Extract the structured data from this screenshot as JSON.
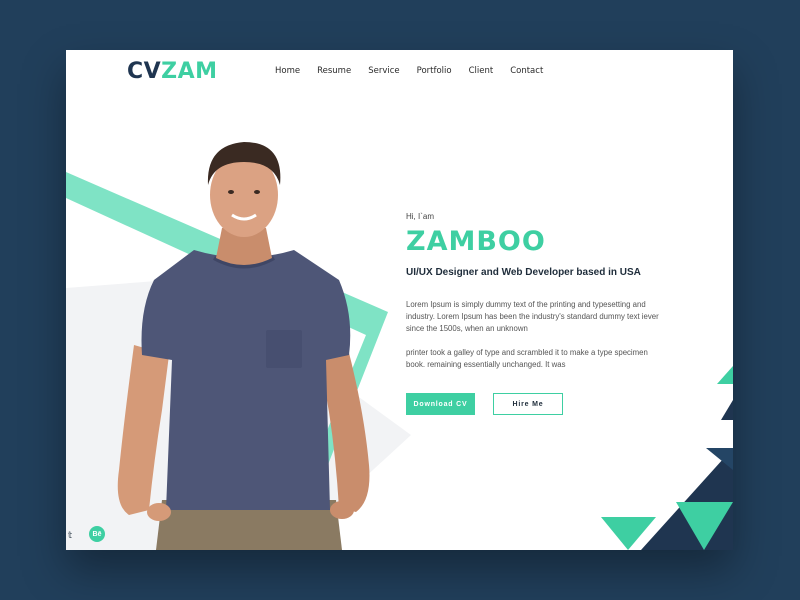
{
  "header": {
    "logo_part1": "CV",
    "logo_part2": "ZAM",
    "nav": [
      "Home",
      "Resume",
      "Service",
      "Portfolio",
      "Client",
      "Contact"
    ]
  },
  "hero": {
    "greeting": "Hi, I`am",
    "name": "ZAMBOO",
    "role": "UI/UX Designer and Web Developer based in USA",
    "para1": "Lorem Ipsum is simply dummy text of the printing and typesetting and industry. Lorem Ipsum has been the industry's standard dummy text iever since the 1500s, when an unknown",
    "para2": "printer took a galley of type and scrambled it to make a type specimen book. remaining essentially unchanged. It was",
    "btn_download": "Download CV",
    "btn_hire": "Hire Me"
  },
  "social": {
    "twitter": "𝕥",
    "behance": "Bē"
  },
  "colors": {
    "accent": "#3ecfa2",
    "navy": "#1f3550",
    "background": "#213f5b"
  },
  "icons": [
    "twitter-icon",
    "behance-icon"
  ]
}
